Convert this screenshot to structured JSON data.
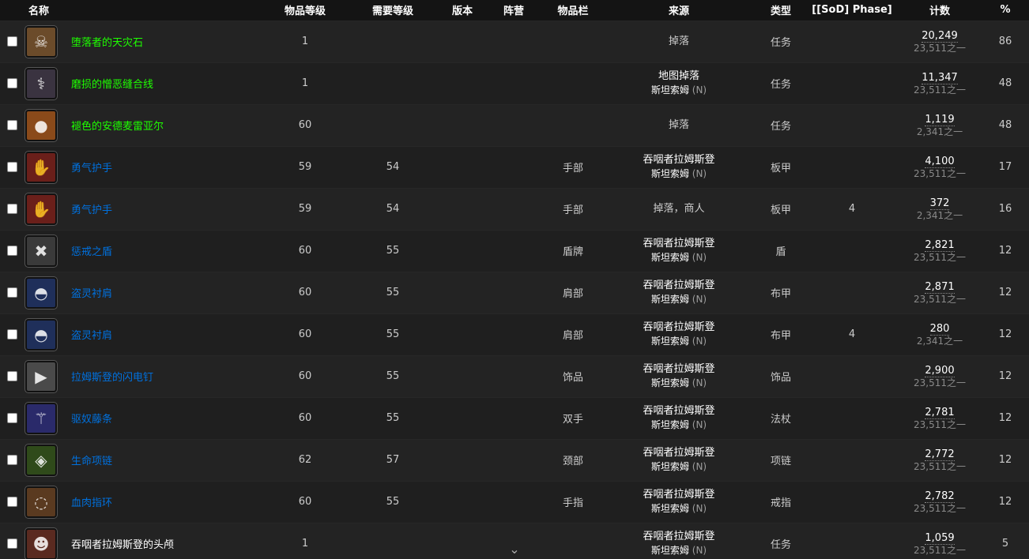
{
  "columns": {
    "name": "名称",
    "item_level": "物品等级",
    "req_level": "需要等级",
    "version": "版本",
    "faction": "阵营",
    "slot": "物品栏",
    "source": "来源",
    "type": "类型",
    "phase": "[[SoD] Phase]",
    "count": "计数",
    "percent": "%"
  },
  "rows": [
    {
      "icon": "skull-stone-icon",
      "icon_bg": "#6b4b2a",
      "glyph": "☠",
      "name": "堕落者的天灾石",
      "quality": "green",
      "ilvl": "1",
      "req": "",
      "slot": "",
      "source_main": "掉落",
      "source_zone": "",
      "source_zone_n": "",
      "type": "任务",
      "phase": "",
      "count": "20,249",
      "count_of": "23,511之一",
      "pct": "86"
    },
    {
      "icon": "thread-icon",
      "icon_bg": "#3a3340",
      "glyph": "⚕",
      "name": "磨损的憎恶缝合线",
      "quality": "green",
      "ilvl": "1",
      "req": "",
      "slot": "",
      "source_main": "地图掉落",
      "source_zone": "斯坦索姆",
      "source_zone_n": "(N)",
      "type": "任务",
      "phase": "",
      "count": "11,347",
      "count_of": "23,511之一",
      "pct": "48"
    },
    {
      "icon": "coin-icon",
      "icon_bg": "#8a4a1a",
      "glyph": "●",
      "name": "褪色的安德麦雷亚尔",
      "quality": "green",
      "ilvl": "60",
      "req": "",
      "slot": "",
      "source_main": "掉落",
      "source_zone": "",
      "source_zone_n": "",
      "type": "任务",
      "phase": "",
      "count": "1,119",
      "count_of": "2,341之一",
      "pct": "48"
    },
    {
      "icon": "plate-gauntlet-icon",
      "icon_bg": "#6a1f1a",
      "glyph": "✋",
      "name": "勇气护手",
      "quality": "blue",
      "ilvl": "59",
      "req": "54",
      "slot": "手部",
      "source_main": "吞咽者拉姆斯登",
      "source_zone": "斯坦索姆",
      "source_zone_n": "(N)",
      "type": "板甲",
      "phase": "",
      "count": "4,100",
      "count_of": "23,511之一",
      "pct": "17"
    },
    {
      "icon": "plate-gauntlet-icon",
      "icon_bg": "#6a1f1a",
      "glyph": "✋",
      "name": "勇气护手",
      "quality": "blue",
      "ilvl": "59",
      "req": "54",
      "slot": "手部",
      "source_main": "掉落，商人",
      "source_zone": "",
      "source_zone_n": "",
      "type": "板甲",
      "phase": "4",
      "count": "372",
      "count_of": "2,341之一",
      "pct": "16"
    },
    {
      "icon": "shield-icon",
      "icon_bg": "#3a3a3a",
      "glyph": "✖",
      "name": "惩戒之盾",
      "quality": "blue",
      "ilvl": "60",
      "req": "55",
      "slot": "盾牌",
      "source_main": "吞咽者拉姆斯登",
      "source_zone": "斯坦索姆",
      "source_zone_n": "(N)",
      "type": "盾",
      "phase": "",
      "count": "2,821",
      "count_of": "23,511之一",
      "pct": "12"
    },
    {
      "icon": "shoulder-icon",
      "icon_bg": "#1f2f5a",
      "glyph": "◓",
      "name": "盗灵衬肩",
      "quality": "blue",
      "ilvl": "60",
      "req": "55",
      "slot": "肩部",
      "source_main": "吞咽者拉姆斯登",
      "source_zone": "斯坦索姆",
      "source_zone_n": "(N)",
      "type": "布甲",
      "phase": "",
      "count": "2,871",
      "count_of": "23,511之一",
      "pct": "12"
    },
    {
      "icon": "shoulder-icon",
      "icon_bg": "#1f2f5a",
      "glyph": "◓",
      "name": "盗灵衬肩",
      "quality": "blue",
      "ilvl": "60",
      "req": "55",
      "slot": "肩部",
      "source_main": "吞咽者拉姆斯登",
      "source_zone": "斯坦索姆",
      "source_zone_n": "(N)",
      "type": "布甲",
      "phase": "4",
      "count": "280",
      "count_of": "2,341之一",
      "pct": "12"
    },
    {
      "icon": "spike-icon",
      "icon_bg": "#4a4a4a",
      "glyph": "▶",
      "name": "拉姆斯登的闪电钉",
      "quality": "blue",
      "ilvl": "60",
      "req": "55",
      "slot": "饰品",
      "source_main": "吞咽者拉姆斯登",
      "source_zone": "斯坦索姆",
      "source_zone_n": "(N)",
      "type": "饰品",
      "phase": "",
      "count": "2,900",
      "count_of": "23,511之一",
      "pct": "12"
    },
    {
      "icon": "staff-icon",
      "icon_bg": "#2a2a6a",
      "glyph": "⚚",
      "name": "驱奴藤条",
      "quality": "blue",
      "ilvl": "60",
      "req": "55",
      "slot": "双手",
      "source_main": "吞咽者拉姆斯登",
      "source_zone": "斯坦索姆",
      "source_zone_n": "(N)",
      "type": "法杖",
      "phase": "",
      "count": "2,781",
      "count_of": "23,511之一",
      "pct": "12"
    },
    {
      "icon": "necklace-icon",
      "icon_bg": "#2f4a1a",
      "glyph": "◈",
      "name": "生命项链",
      "quality": "blue",
      "ilvl": "62",
      "req": "57",
      "slot": "颈部",
      "source_main": "吞咽者拉姆斯登",
      "source_zone": "斯坦索姆",
      "source_zone_n": "(N)",
      "type": "项链",
      "phase": "",
      "count": "2,772",
      "count_of": "23,511之一",
      "pct": "12"
    },
    {
      "icon": "ring-icon",
      "icon_bg": "#5a3a20",
      "glyph": "◌",
      "name": "血肉指环",
      "quality": "blue",
      "ilvl": "60",
      "req": "55",
      "slot": "手指",
      "source_main": "吞咽者拉姆斯登",
      "source_zone": "斯坦索姆",
      "source_zone_n": "(N)",
      "type": "戒指",
      "phase": "",
      "count": "2,782",
      "count_of": "23,511之一",
      "pct": "12"
    },
    {
      "icon": "head-icon",
      "icon_bg": "#5a2a20",
      "glyph": "☻",
      "name": "吞咽者拉姆斯登的头颅",
      "quality": "white",
      "ilvl": "1",
      "req": "",
      "slot": "",
      "source_main": "吞咽者拉姆斯登",
      "source_zone": "斯坦索姆",
      "source_zone_n": "(N)",
      "type": "任务",
      "phase": "",
      "count": "1,059",
      "count_of": "23,511之一",
      "pct": "5"
    }
  ]
}
